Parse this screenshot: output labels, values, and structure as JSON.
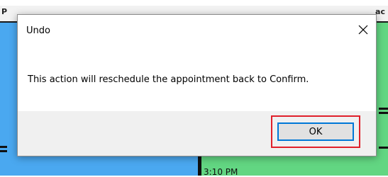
{
  "background": {
    "tab_left": "P",
    "tab_right": "ac",
    "time_label": "3:10 PM",
    "colors": {
      "blue_pane": "#4aa8f0",
      "green_pane": "#62d682"
    }
  },
  "dialog": {
    "title": "Undo",
    "close_icon": "close-icon",
    "message": "This action will reschedule the appointment back to Confirm.",
    "ok_label": "OK",
    "highlight_color": "#e0202a"
  }
}
